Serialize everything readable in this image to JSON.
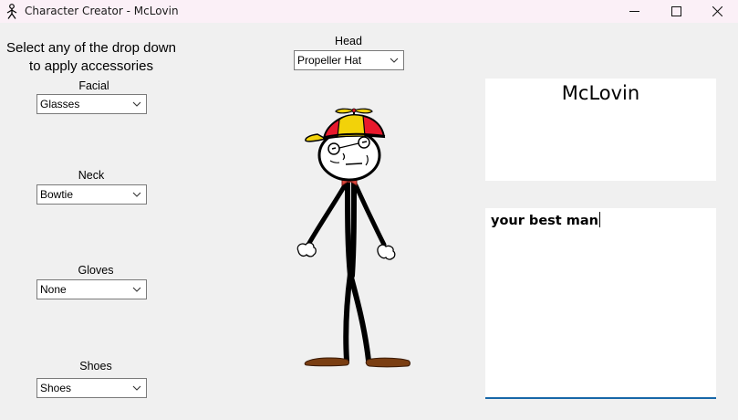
{
  "window": {
    "title": "Character Creator - McLovin",
    "icon": "stick-figure-icon"
  },
  "instructions": {
    "line1": "Select any of the drop down",
    "line2": "to apply accessories"
  },
  "head": {
    "label": "Head",
    "value": "Propeller Hat"
  },
  "facial": {
    "label": "Facial",
    "value": "Glasses"
  },
  "neck": {
    "label": "Neck",
    "value": "Bowtie"
  },
  "gloves": {
    "label": "Gloves",
    "value": "None"
  },
  "shoes": {
    "label": "Shoes",
    "value": "Shoes"
  },
  "character": {
    "name": "McLovin",
    "description": "your best man"
  },
  "colors": {
    "hat_red": "#e8192c",
    "hat_yellow": "#f2d20a",
    "bowtie": "#e0463c",
    "shoes": "#7a3e12",
    "accent_underline": "#1767a8"
  }
}
